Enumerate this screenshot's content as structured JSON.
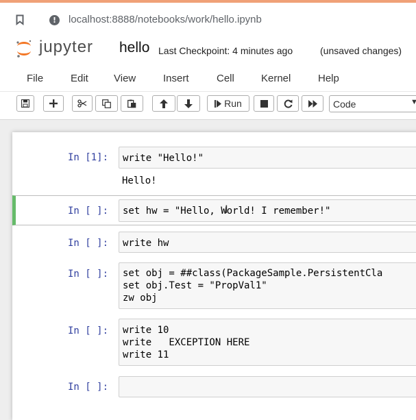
{
  "browser": {
    "url": "localhost:8888/notebooks/work/hello.ipynb"
  },
  "header": {
    "logo_text": "jupyter",
    "notebook_name": "hello",
    "checkpoint": "Last Checkpoint: 4 minutes ago",
    "save_status": "(unsaved changes)"
  },
  "menu": {
    "items": [
      "File",
      "Edit",
      "View",
      "Insert",
      "Cell",
      "Kernel",
      "Help"
    ]
  },
  "toolbar": {
    "run_label": "Run",
    "cell_type": "Code"
  },
  "cells": [
    {
      "prompt": "In [1]:",
      "code": "write \"Hello!\"",
      "output": "Hello!"
    },
    {
      "prompt": "In [ ]:",
      "code": "set hw = \"Hello, World! I remember!\""
    },
    {
      "prompt": "In [ ]:",
      "code": "write hw"
    },
    {
      "prompt": "In [ ]:",
      "code": "set obj = ##class(PackageSample.PersistentCla\nset obj.Test = \"PropVal1\"\nzw obj"
    },
    {
      "prompt": "In [ ]:",
      "code": "write 10\nwrite   EXCEPTION HERE\nwrite 11"
    },
    {
      "prompt": "In [ ]:",
      "code": ""
    }
  ],
  "colors": {
    "accent_stripe": "#f0a178",
    "prompt": "#303f9f",
    "selected_cell": "#66bb6a",
    "jupyter_orange": "#f37726"
  }
}
